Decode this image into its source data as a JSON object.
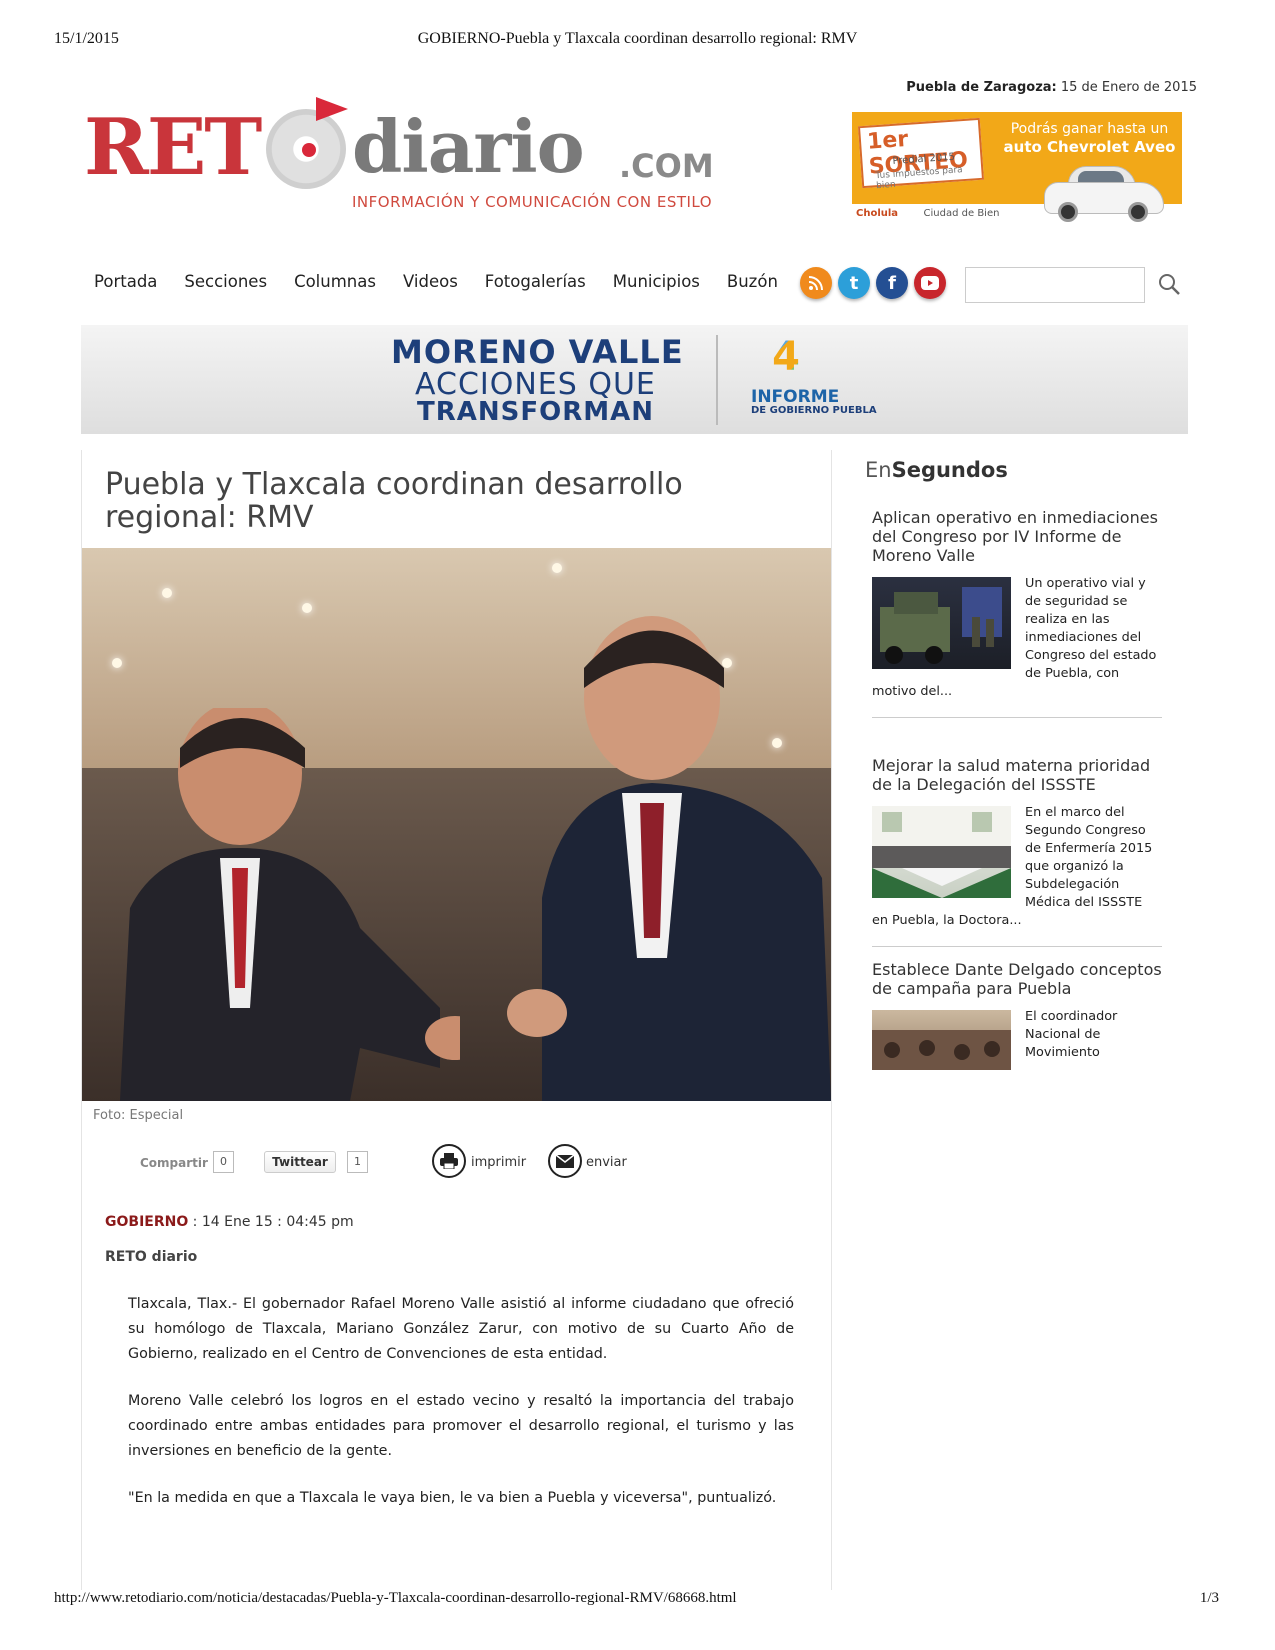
{
  "print_header": {
    "date": "15/1/2015",
    "title": "GOBIERNO-Puebla y Tlaxcala coordinan desarrollo regional: RMV"
  },
  "print_footer": {
    "url": "http://www.retodiario.com/noticia/destacadas/Puebla-y-Tlaxcala-coordinan-desarrollo-regional-RMV/68668.html",
    "page": "1/3"
  },
  "dateline": {
    "city": "Puebla de Zaragoza:",
    "date": "15 de Enero de 2015"
  },
  "logo": {
    "reto": "RET",
    "diario": "diario",
    "com": ".COM",
    "tagline": "INFORMACIÓN Y COMUNICACIÓN CON ESTILO"
  },
  "ad_top": {
    "sorteo": "1er SORTEO",
    "predial": "Predial 2015",
    "tus": "Tus impuestos para bien",
    "ganar_1": "Podrás ganar hasta un",
    "ganar_2": "auto Chevrolet Aveo",
    "sponsor_1": "Cholula",
    "sponsor_2": "Ciudad de Bien"
  },
  "nav": {
    "items": [
      "Portada",
      "Secciones",
      "Columnas",
      "Videos",
      "Fotogalerías",
      "Municipios",
      "Buzón"
    ]
  },
  "social": {
    "icons": [
      "rss-icon",
      "twitter-icon",
      "facebook-icon",
      "youtube-icon"
    ],
    "colors": {
      "rss": "#f08a1c",
      "twitter": "#2c9fd9",
      "facebook": "#244f93",
      "youtube": "#c8262c"
    }
  },
  "search": {
    "value": "",
    "placeholder": ""
  },
  "banner": {
    "line1": "MORENO VALLE",
    "line2": "ACCIONES QUE",
    "line3": "TRANSFORMAN",
    "number": "4",
    "informe": "INFORME",
    "de_gobierno": "DE GOBIERNO PUEBLA"
  },
  "article": {
    "title": "Puebla y Tlaxcala coordinan desarrollo regional: RMV",
    "photo_caption": "Foto: Especial",
    "share": {
      "compartir_label": "Compartir",
      "compartir_count": "0",
      "twittear_label": "Twittear",
      "twittear_count": "1",
      "imprimir_label": "imprimir",
      "enviar_label": "enviar"
    },
    "section": "GOBIERNO",
    "separator": " : ",
    "timestamp": "14 Ene 15 : 04:45 pm",
    "byline": "RETO diario",
    "paragraphs": [
      "Tlaxcala, Tlax.- El gobernador Rafael Moreno Valle asistió al informe ciudadano que ofreció su homólogo de Tlaxcala, Mariano González Zarur, con motivo de su Cuarto Año de Gobierno, realizado en el Centro de Convenciones de esta entidad.",
      "Moreno Valle celebró los logros en el estado vecino y resaltó la importancia del trabajo coordinado entre ambas entidades para promover el desarrollo regional, el turismo y las inversiones en beneficio de la gente.",
      "\"En la medida en que a Tlaxcala le vaya bien, le va bien a Puebla y viceversa\", puntualizó."
    ],
    "colors": {
      "section": "#8b1a1a"
    }
  },
  "sidebar": {
    "title_en": "En",
    "title_segundos": "Segundos",
    "items": [
      {
        "headline": "Aplican operativo en inmediaciones del Congreso por IV Informe de Moreno Valle",
        "summary": "Un operativo vial y de seguridad se realiza en las inmediaciones del Congreso del estado de Puebla, con motivo del..."
      },
      {
        "headline": "Mejorar la salud materna prioridad de la Delegación del ISSSTE",
        "summary": "En el marco del Segundo Congreso de Enfermería 2015 que organizó la Subdelegación Médica del ISSSTE en Puebla, la Doctora..."
      },
      {
        "headline": "Establece Dante Delgado conceptos de campaña para Puebla",
        "summary": "El coordinador Nacional de Movimiento"
      }
    ]
  }
}
